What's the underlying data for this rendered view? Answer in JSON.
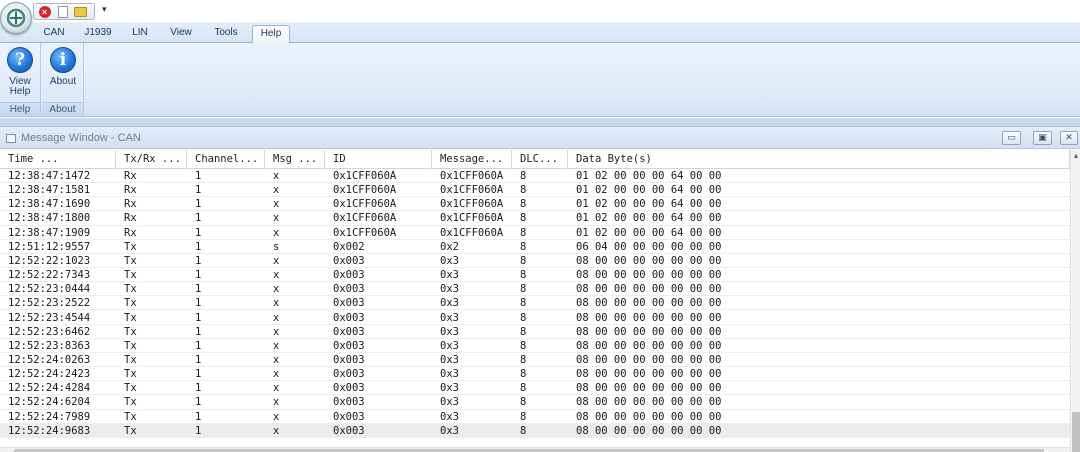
{
  "quick_access": {
    "close_icon": "close-icon",
    "new_icon": "new-document-icon",
    "open_icon": "open-folder-icon",
    "more_glyph": "▾"
  },
  "tabs": [
    {
      "label": "CAN",
      "active": false
    },
    {
      "label": "J1939",
      "active": false
    },
    {
      "label": "LIN",
      "active": false
    },
    {
      "label": "View",
      "active": false
    },
    {
      "label": "Tools",
      "active": false
    },
    {
      "label": "Help",
      "active": true
    }
  ],
  "ribbon": {
    "view_help": {
      "label_line1": "View",
      "label_line2": "Help",
      "icon": "question-icon",
      "glyph": "?"
    },
    "about": {
      "label": "About",
      "icon": "info-icon",
      "glyph": "i"
    },
    "group_help": "Help",
    "group_about": "About"
  },
  "message_window": {
    "title": "Message Window - CAN",
    "buttons": {
      "minimize": "▭",
      "maximize": "▣",
      "close": "✕"
    }
  },
  "columns": [
    "Time          ...",
    "Tx/Rx ...",
    "Channel...",
    "Msg ...",
    "ID",
    "Message...",
    "DLC...",
    "Data Byte(s)"
  ],
  "rows": [
    [
      "12:38:47:1472",
      "Rx",
      "1",
      "x",
      "0x1CFF060A",
      "0x1CFF060A",
      "8",
      "01 02 00 00 00 64 00 00"
    ],
    [
      "12:38:47:1581",
      "Rx",
      "1",
      "x",
      "0x1CFF060A",
      "0x1CFF060A",
      "8",
      "01 02 00 00 00 64 00 00"
    ],
    [
      "12:38:47:1690",
      "Rx",
      "1",
      "x",
      "0x1CFF060A",
      "0x1CFF060A",
      "8",
      "01 02 00 00 00 64 00 00"
    ],
    [
      "12:38:47:1800",
      "Rx",
      "1",
      "x",
      "0x1CFF060A",
      "0x1CFF060A",
      "8",
      "01 02 00 00 00 64 00 00"
    ],
    [
      "12:38:47:1909",
      "Rx",
      "1",
      "x",
      "0x1CFF060A",
      "0x1CFF060A",
      "8",
      "01 02 00 00 00 64 00 00"
    ],
    [
      "12:51:12:9557",
      "Tx",
      "1",
      "s",
      "0x002",
      "0x2",
      "8",
      "06 04 00 00 00 00 00 00"
    ],
    [
      "12:52:22:1023",
      "Tx",
      "1",
      "x",
      "0x003",
      "0x3",
      "8",
      "08 00 00 00 00 00 00 00"
    ],
    [
      "12:52:22:7343",
      "Tx",
      "1",
      "x",
      "0x003",
      "0x3",
      "8",
      "08 00 00 00 00 00 00 00"
    ],
    [
      "12:52:23:0444",
      "Tx",
      "1",
      "x",
      "0x003",
      "0x3",
      "8",
      "08 00 00 00 00 00 00 00"
    ],
    [
      "12:52:23:2522",
      "Tx",
      "1",
      "x",
      "0x003",
      "0x3",
      "8",
      "08 00 00 00 00 00 00 00"
    ],
    [
      "12:52:23:4544",
      "Tx",
      "1",
      "x",
      "0x003",
      "0x3",
      "8",
      "08 00 00 00 00 00 00 00"
    ],
    [
      "12:52:23:6462",
      "Tx",
      "1",
      "x",
      "0x003",
      "0x3",
      "8",
      "08 00 00 00 00 00 00 00"
    ],
    [
      "12:52:23:8363",
      "Tx",
      "1",
      "x",
      "0x003",
      "0x3",
      "8",
      "08 00 00 00 00 00 00 00"
    ],
    [
      "12:52:24:0263",
      "Tx",
      "1",
      "x",
      "0x003",
      "0x3",
      "8",
      "08 00 00 00 00 00 00 00"
    ],
    [
      "12:52:24:2423",
      "Tx",
      "1",
      "x",
      "0x003",
      "0x3",
      "8",
      "08 00 00 00 00 00 00 00"
    ],
    [
      "12:52:24:4284",
      "Tx",
      "1",
      "x",
      "0x003",
      "0x3",
      "8",
      "08 00 00 00 00 00 00 00"
    ],
    [
      "12:52:24:6204",
      "Tx",
      "1",
      "x",
      "0x003",
      "0x3",
      "8",
      "08 00 00 00 00 00 00 00"
    ],
    [
      "12:52:24:7989",
      "Tx",
      "1",
      "x",
      "0x003",
      "0x3",
      "8",
      "08 00 00 00 00 00 00 00"
    ],
    [
      "12:52:24:9683",
      "Tx",
      "1",
      "x",
      "0x003",
      "0x3",
      "8",
      "08 00 00 00 00 00 00 00"
    ]
  ],
  "scroll": {
    "up_glyph": "▴",
    "down_glyph": "▾"
  }
}
